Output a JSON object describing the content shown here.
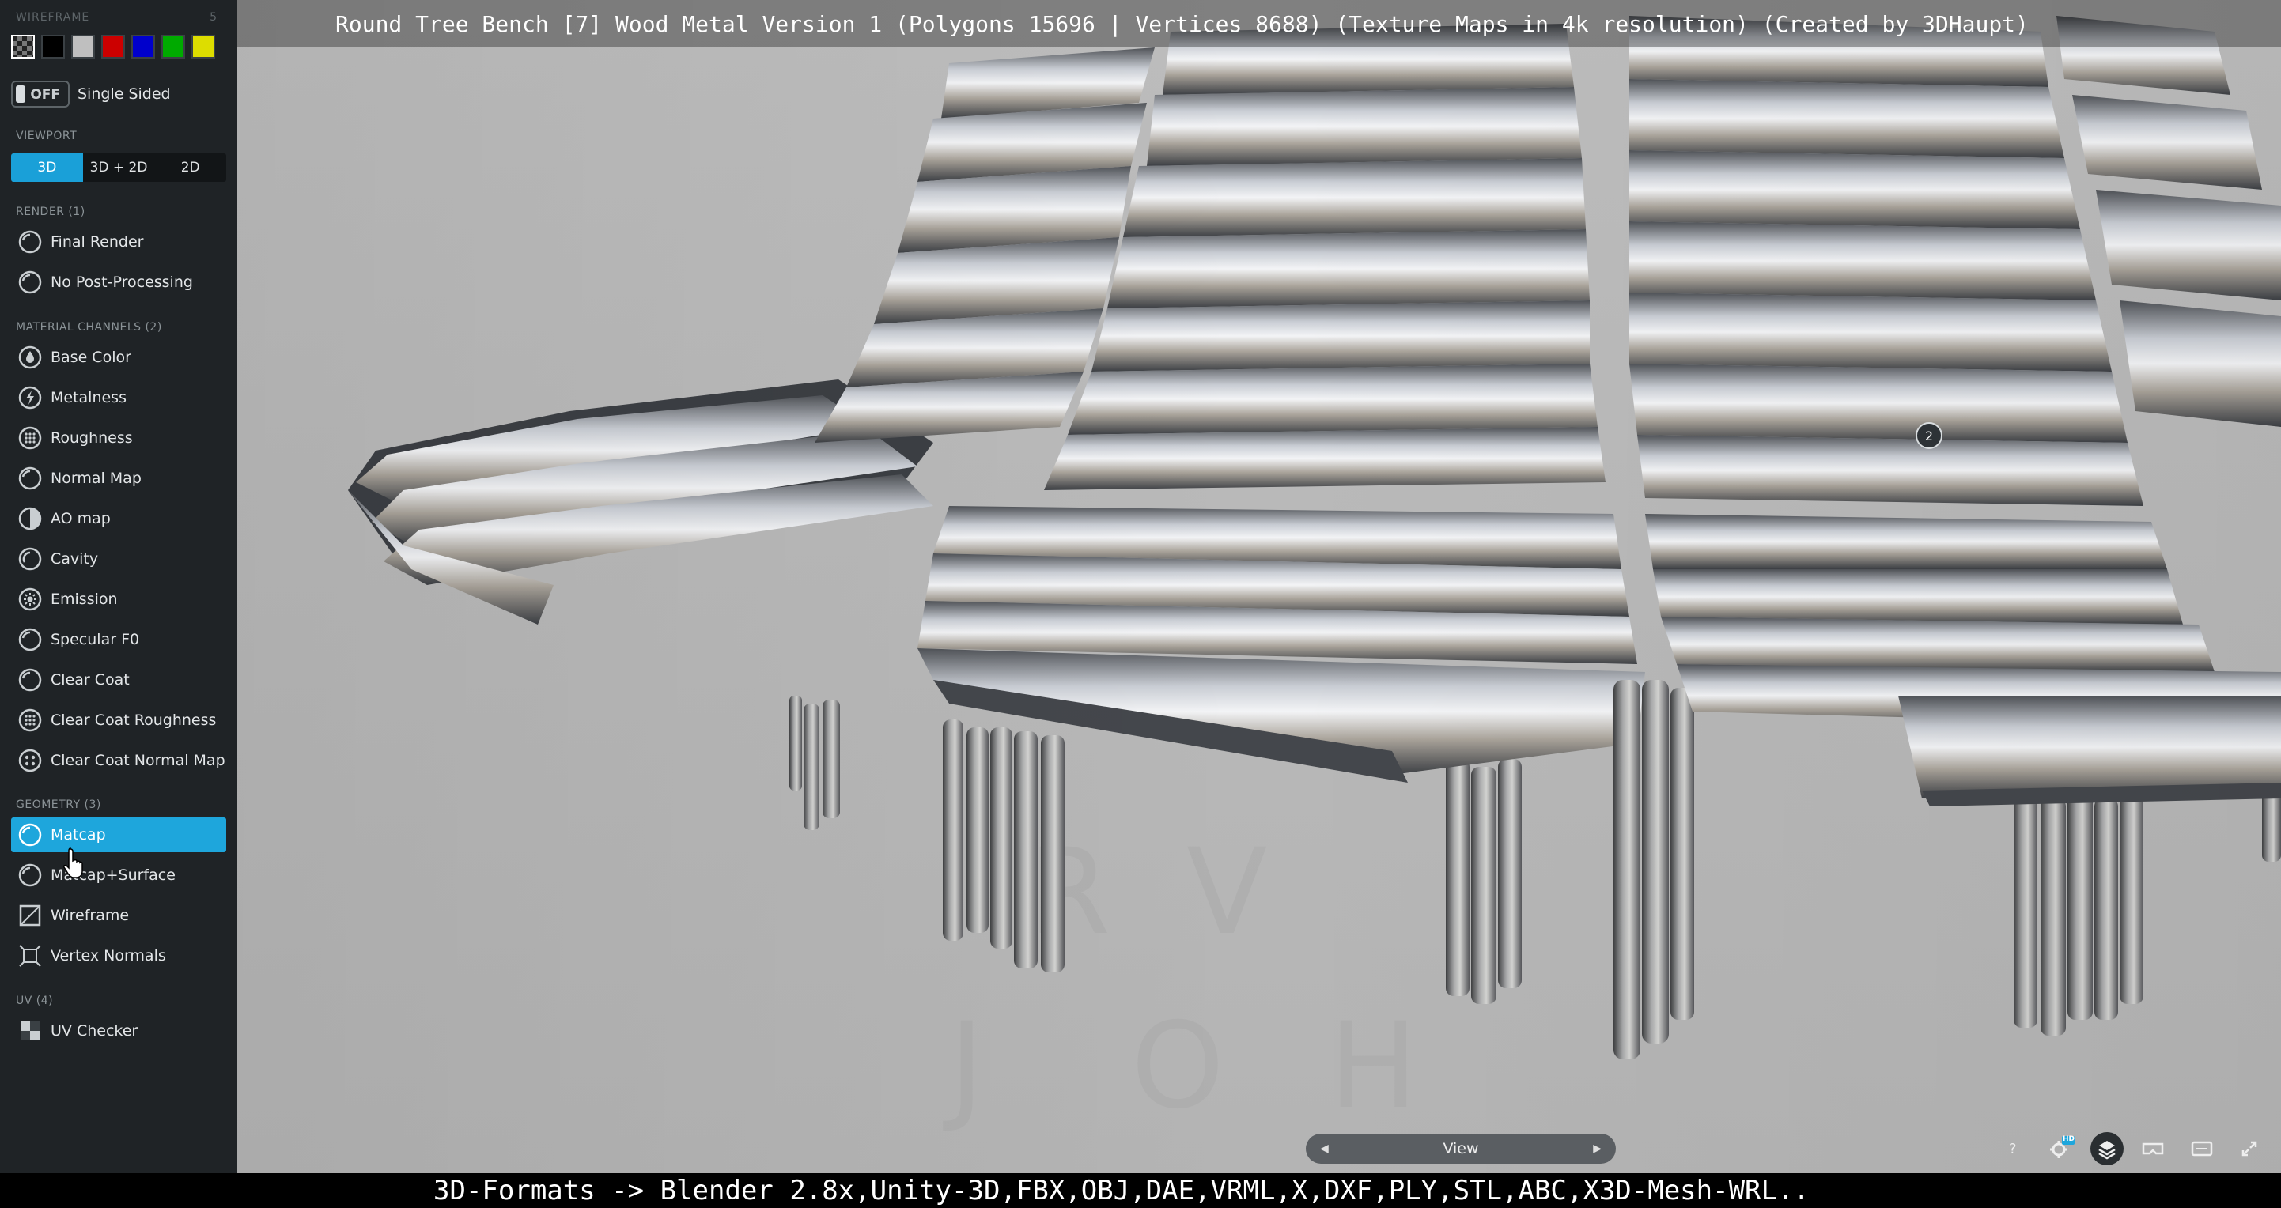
{
  "window": {
    "title": "Round Tree Bench [7] Wood Metal Version 1 (Polygons 15696 | Vertices 8688) (Texture Maps in 4k resolution) (Created by 3DHaupt)"
  },
  "sidebar": {
    "wireframe_label": "WIREFRAME",
    "wireframe_count": "5",
    "swatches": [
      "#3a3a3a",
      "#000000",
      "#bfbfbf",
      "#cc0000",
      "#0000cc",
      "#00aa00",
      "#dddd00"
    ],
    "single_sided": {
      "toggle_text": "OFF",
      "label": "Single Sided"
    },
    "viewport_section": "VIEWPORT",
    "viewport_buttons": [
      "3D",
      "3D + 2D",
      "2D"
    ],
    "render_section": "RENDER (1)",
    "render_items": [
      "Final Render",
      "No Post-Processing"
    ],
    "material_section": "MATERIAL CHANNELS (2)",
    "material_items": [
      "Base Color",
      "Metalness",
      "Roughness",
      "Normal Map",
      "AO map",
      "Cavity",
      "Emission",
      "Specular F0",
      "Clear Coat",
      "Clear Coat Roughness",
      "Clear Coat Normal Map"
    ],
    "geometry_section": "GEOMETRY (3)",
    "geometry_items": [
      "Matcap",
      "Matcap+Surface",
      "Wireframe",
      "Vertex Normals"
    ],
    "uv_section": "UV (4)",
    "uv_items": [
      "UV Checker"
    ],
    "active_item": "Matcap",
    "accent_color": "#1ea6dc"
  },
  "viewport": {
    "annotation_number": "2",
    "nav_label": "View",
    "corner_icons": [
      "help-icon",
      "settings-hd-icon",
      "layers-icon",
      "vr-icon",
      "embed-icon",
      "fullscreen-icon"
    ],
    "hd_badge": "HD"
  },
  "footer": {
    "formats_text": "3D-Formats -> Blender 2.8x,Unity-3D,FBX,OBJ,DAE,VRML,X,DXF,PLY,STL,ABC,X3D-Mesh-WRL.."
  }
}
